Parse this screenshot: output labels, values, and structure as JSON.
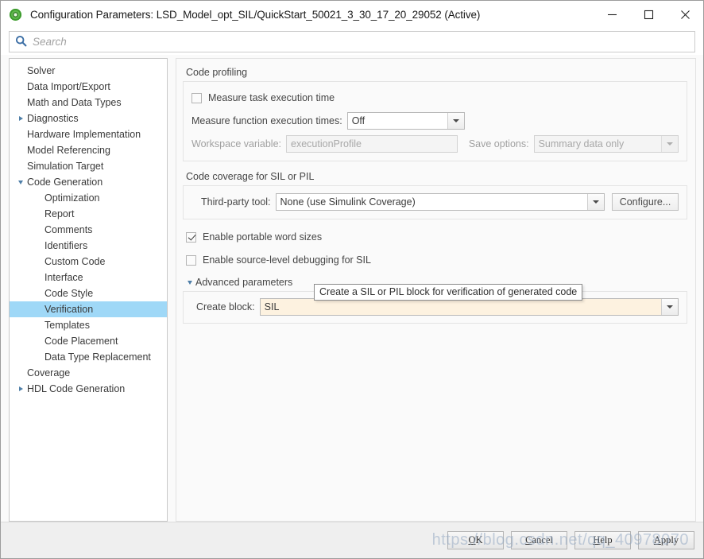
{
  "window": {
    "title": "Configuration Parameters: LSD_Model_opt_SIL/QuickStart_50021_3_30_17_20_29052 (Active)",
    "app_icon": "simulink-icon",
    "minimize": "─",
    "maximize": "□",
    "close": "✕"
  },
  "search": {
    "placeholder": "Search",
    "value": "",
    "icon": "search-icon"
  },
  "sidebar": {
    "items": [
      {
        "label": "Solver",
        "level": 0,
        "twisty": "none",
        "selected": false
      },
      {
        "label": "Data Import/Export",
        "level": 0,
        "twisty": "none",
        "selected": false
      },
      {
        "label": "Math and Data Types",
        "level": 0,
        "twisty": "none",
        "selected": false
      },
      {
        "label": "Diagnostics",
        "level": 0,
        "twisty": "collapsed",
        "selected": false
      },
      {
        "label": "Hardware Implementation",
        "level": 0,
        "twisty": "none",
        "selected": false
      },
      {
        "label": "Model Referencing",
        "level": 0,
        "twisty": "none",
        "selected": false
      },
      {
        "label": "Simulation Target",
        "level": 0,
        "twisty": "none",
        "selected": false
      },
      {
        "label": "Code Generation",
        "level": 0,
        "twisty": "expanded",
        "selected": false
      },
      {
        "label": "Optimization",
        "level": 1,
        "twisty": "none",
        "selected": false
      },
      {
        "label": "Report",
        "level": 1,
        "twisty": "none",
        "selected": false
      },
      {
        "label": "Comments",
        "level": 1,
        "twisty": "none",
        "selected": false
      },
      {
        "label": "Identifiers",
        "level": 1,
        "twisty": "none",
        "selected": false
      },
      {
        "label": "Custom Code",
        "level": 1,
        "twisty": "none",
        "selected": false
      },
      {
        "label": "Interface",
        "level": 1,
        "twisty": "none",
        "selected": false
      },
      {
        "label": "Code Style",
        "level": 1,
        "twisty": "none",
        "selected": false
      },
      {
        "label": "Verification",
        "level": 1,
        "twisty": "none",
        "selected": true
      },
      {
        "label": "Templates",
        "level": 1,
        "twisty": "none",
        "selected": false
      },
      {
        "label": "Code Placement",
        "level": 1,
        "twisty": "none",
        "selected": false
      },
      {
        "label": "Data Type Replacement",
        "level": 1,
        "twisty": "none",
        "selected": false
      },
      {
        "label": "Coverage",
        "level": 0,
        "twisty": "none",
        "selected": false
      },
      {
        "label": "HDL Code Generation",
        "level": 0,
        "twisty": "collapsed",
        "selected": false
      }
    ]
  },
  "main": {
    "code_profiling": {
      "title": "Code profiling",
      "measure_task_execution_time": {
        "label": "Measure task execution time",
        "checked": false
      },
      "measure_function_execution_times": {
        "label": "Measure function execution times:",
        "value": "Off"
      },
      "workspace_variable": {
        "label": "Workspace variable:",
        "value": "executionProfile",
        "enabled": false
      },
      "save_options": {
        "label": "Save options:",
        "value": "Summary data only",
        "enabled": false
      }
    },
    "code_coverage": {
      "title": "Code coverage for SIL or PIL",
      "third_party_tool": {
        "label": "Third-party tool:",
        "value": "None (use Simulink Coverage)"
      },
      "configure_button": "Configure..."
    },
    "enable_portable_word_sizes": {
      "label": "Enable portable word sizes",
      "checked": true
    },
    "enable_source_level_debugging": {
      "label": "Enable source-level debugging for SIL",
      "checked": false
    },
    "advanced_parameters": {
      "label": "Advanced parameters",
      "expanded": true,
      "create_block": {
        "label": "Create block:",
        "value": "SIL"
      }
    },
    "tooltip": "Create a SIL or PIL block for verification of generated code"
  },
  "footer": {
    "buttons": [
      {
        "prefix": "",
        "mnemonic": "O",
        "suffix": "K",
        "name": "ok-button"
      },
      {
        "prefix": "",
        "mnemonic": "C",
        "suffix": "ancel",
        "name": "cancel-button"
      },
      {
        "prefix": "",
        "mnemonic": "H",
        "suffix": "elp",
        "name": "help-button"
      },
      {
        "prefix": "",
        "mnemonic": "A",
        "suffix": "pply",
        "name": "apply-button"
      }
    ],
    "watermark": "https://blog.csdn.net/qq_40978070"
  },
  "colors": {
    "selection": "#9fd8f7",
    "modified_field": "#fdf2e0",
    "twisty": "#4f7fa8",
    "search_icon": "#3b6ea5"
  }
}
